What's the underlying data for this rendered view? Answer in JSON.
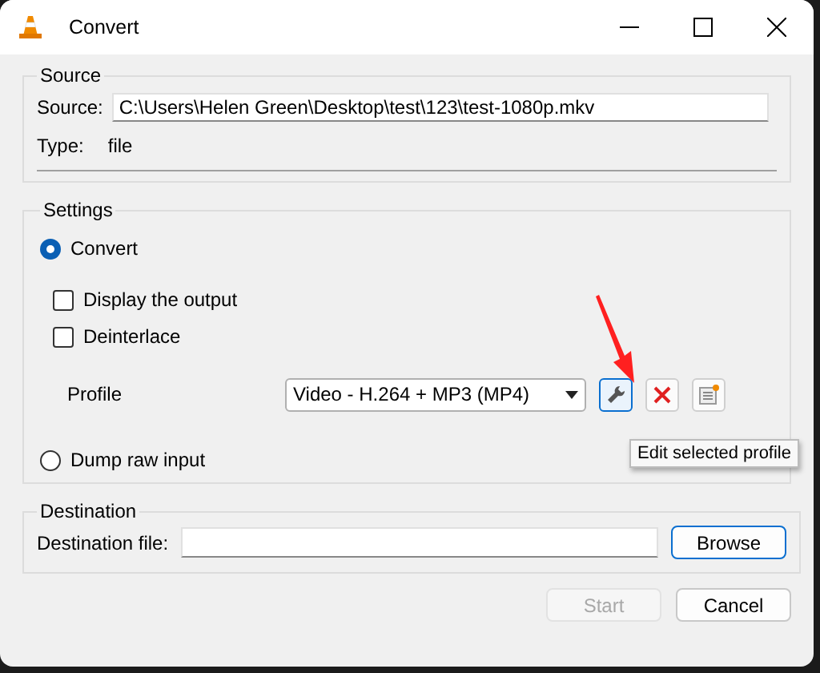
{
  "window": {
    "title": "Convert"
  },
  "source": {
    "title": "Source",
    "source_label": "Source:",
    "source_value": "C:\\Users\\Helen Green\\Desktop\\test\\123\\test-1080p.mkv",
    "type_label": "Type:",
    "type_value": "file"
  },
  "settings": {
    "title": "Settings",
    "convert": {
      "label": "Convert",
      "selected": true
    },
    "checkboxes": [
      {
        "label": "Display the output",
        "checked": false
      },
      {
        "label": "Deinterlace",
        "checked": false
      }
    ],
    "profile": {
      "label": "Profile",
      "value": "Video - H.264 + MP3 (MP4)"
    },
    "dump": {
      "label": "Dump raw input",
      "selected": false
    }
  },
  "tooltip": {
    "text": "Edit selected profile"
  },
  "destination": {
    "title": "Destination",
    "label": "Destination file:",
    "browse": "Browse"
  },
  "buttons": [
    {
      "label": "Start",
      "disabled": true
    },
    {
      "label": "Cancel",
      "disabled": false
    }
  ]
}
